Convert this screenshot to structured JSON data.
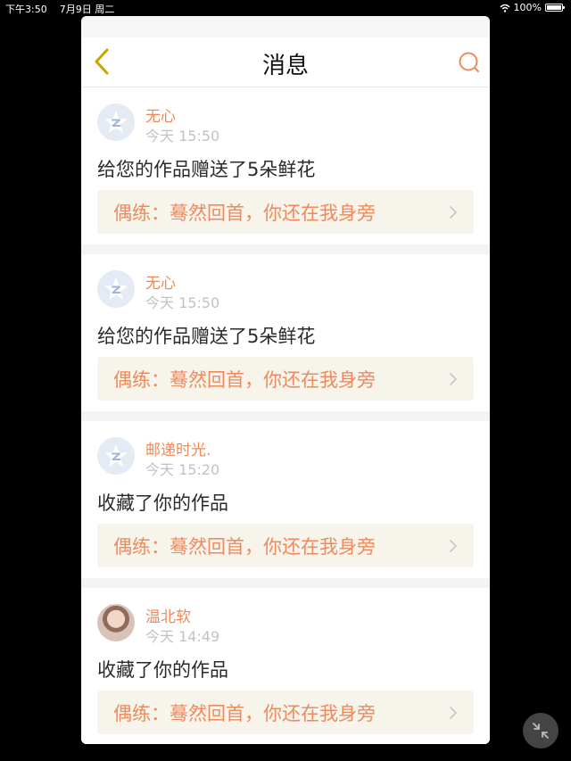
{
  "status_bar": {
    "time": "下午3:50",
    "date": "7月9日 周二",
    "battery": "100%"
  },
  "nav": {
    "title": "消息",
    "back_icon": "chevron-left-icon",
    "search_icon": "search-icon"
  },
  "colors": {
    "accent": "#ee8a5c",
    "back_icon": "#c9a400",
    "link_background": "#f7f4ec"
  },
  "messages": [
    {
      "user": "无心",
      "time": "今天 15:50",
      "text": "给您的作品赠送了5朵鲜花",
      "work": "偶练：蓦然回首，你还在我身旁",
      "avatar": "default-avatar"
    },
    {
      "user": "无心",
      "time": "今天 15:50",
      "text": "给您的作品赠送了5朵鲜花",
      "work": "偶练：蓦然回首，你还在我身旁",
      "avatar": "default-avatar"
    },
    {
      "user": "邮递时光.",
      "time": "今天 15:20",
      "text": "收藏了你的作品",
      "work": "偶练：蓦然回首，你还在我身旁",
      "avatar": "default-avatar"
    },
    {
      "user": "温北软",
      "time": "今天 14:49",
      "text": "收藏了你的作品",
      "work": "偶练：蓦然回首，你还在我身旁",
      "avatar": "photo-avatar"
    }
  ]
}
